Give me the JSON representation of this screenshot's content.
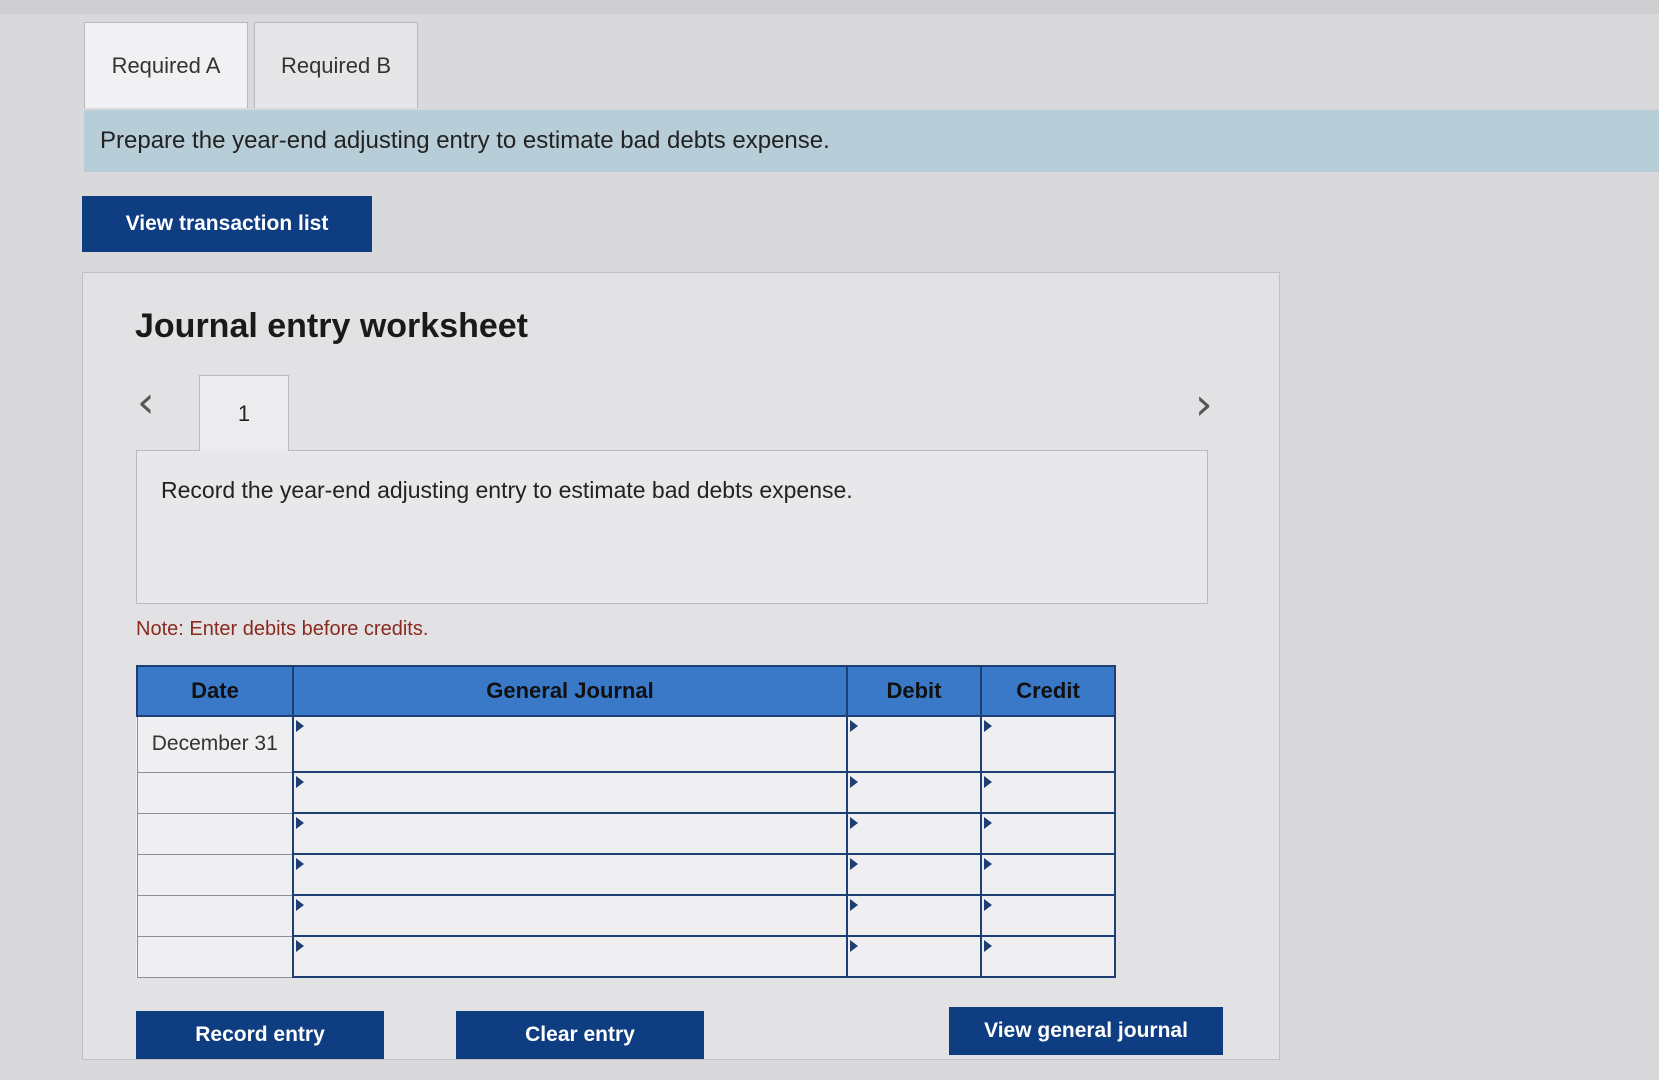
{
  "tabs": [
    {
      "label": "Required A"
    },
    {
      "label": "Required B"
    }
  ],
  "instruction": "Prepare the year-end adjusting entry to estimate bad debts expense.",
  "buttons": {
    "view_transaction_list": "View transaction list",
    "record_entry": "Record entry",
    "clear_entry": "Clear entry",
    "view_general_journal": "View general journal"
  },
  "worksheet": {
    "title": "Journal entry worksheet",
    "step": "1",
    "prev_icon": "‹",
    "next_icon": "›",
    "description": "Record the year-end adjusting entry to estimate bad debts expense.",
    "note": "Note: Enter debits before credits."
  },
  "journal": {
    "headers": {
      "date": "Date",
      "account": "General Journal",
      "debit": "Debit",
      "credit": "Credit"
    },
    "rows": [
      {
        "date": "December 31",
        "account": "",
        "debit": "",
        "credit": ""
      },
      {
        "date": "",
        "account": "",
        "debit": "",
        "credit": ""
      },
      {
        "date": "",
        "account": "",
        "debit": "",
        "credit": ""
      },
      {
        "date": "",
        "account": "",
        "debit": "",
        "credit": ""
      },
      {
        "date": "",
        "account": "",
        "debit": "",
        "credit": ""
      },
      {
        "date": "",
        "account": "",
        "debit": "",
        "credit": ""
      }
    ]
  },
  "colors": {
    "button_bg": "#0f3d82",
    "table_header_bg": "#3a78c8",
    "instruction_bg": "#b7cdd8",
    "note_text": "#8a2a1e"
  }
}
